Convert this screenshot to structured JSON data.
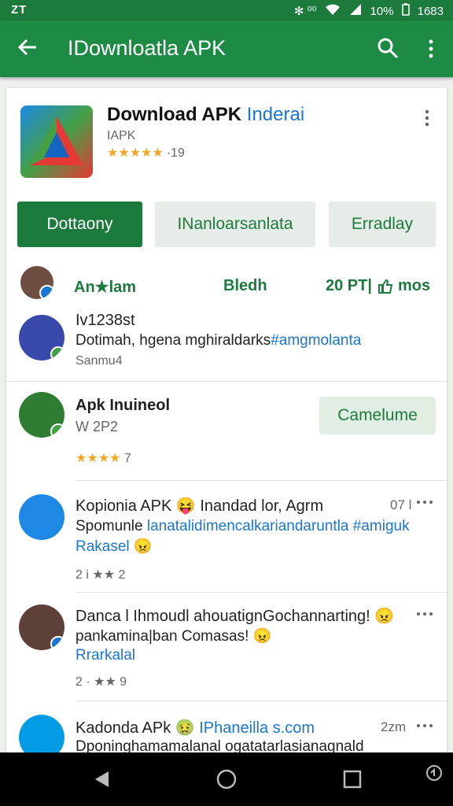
{
  "status_bar": {
    "left": "ZT",
    "right_icons": "✻ ⁰⁰",
    "battery": "10%",
    "time": "1683"
  },
  "app_bar": {
    "title": "IDownloatla APK"
  },
  "app": {
    "title": "Download APK ",
    "title_accent": "Inderai",
    "subtitle": "IAPK",
    "stars": "★★★★★",
    "rating_count": "·19"
  },
  "buttons": [
    "Dottaony",
    "INanloarsanlata",
    "Erradlay"
  ],
  "stats": {
    "left_label": "An★lam",
    "mid_label": "Bledh",
    "right_label": "20 PT|",
    "right_action": "mos"
  },
  "reviews": [
    {
      "name": "Iv1238st",
      "body": "Dotimah, hgena mghiraldarks",
      "hashtag": "#amgmolanta",
      "meta": "Sanmu4"
    },
    {
      "name": "Apk Inuineol",
      "sub": "W 2P2",
      "stars": "★★★★",
      "count": "7",
      "action": "Camelume"
    },
    {
      "name": "Kopionia APK 😝 Inandad lor, Agrm",
      "time": "07 l",
      "body": "Spomunle ",
      "body_link": "lanatalidimencalkariandaruntla #amiguk",
      "body2": "Rakasel 😠",
      "meta": "2 i ★★ 2"
    },
    {
      "name": "Danca l Ihmoudl ahouatignGochannarting! 😠",
      "body": "pankamina|ban Comasas! 😠",
      "link": "Rrarkalal",
      "meta": "2 · ★★ 9"
    },
    {
      "name": "Kadonda APk 🤢 ",
      "name_link": "IPhaneilla s.com",
      "time": "2zm",
      "body": "Dponinghamamalanal ogatatarlasianagnald"
    }
  ],
  "colors": {
    "primary": "#1e8b45",
    "primary_dark": "#1b7a3c",
    "accent": "#1976d2",
    "star": "#f5a623"
  }
}
